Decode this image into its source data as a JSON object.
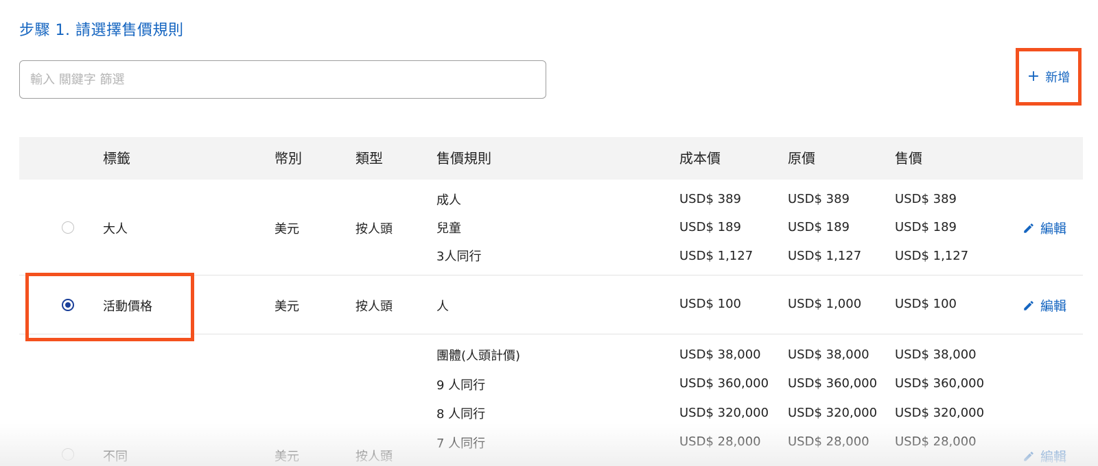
{
  "step_title": "步驟 1. 請選擇售價規則",
  "search": {
    "placeholder": "輸入 關鍵字 篩選",
    "value": ""
  },
  "add_button": {
    "icon": "plus-icon",
    "label": "新增"
  },
  "colors": {
    "accent": "#1565c0",
    "highlight": "#f4511e",
    "radio_checked": "#1a3f99",
    "header_bg": "#f3f3f3"
  },
  "table": {
    "headers": {
      "label": "標籤",
      "currency": "幣別",
      "type": "類型",
      "rule": "售價規則",
      "cost": "成本價",
      "original": "原價",
      "sale": "售價"
    },
    "rows": [
      {
        "selected": false,
        "label": "大人",
        "currency": "美元",
        "type": "按人頭",
        "rules": [
          {
            "name": "成人",
            "cost": "USD$ 389",
            "original": "USD$ 389",
            "sale": "USD$ 389"
          },
          {
            "name": "兒童",
            "cost": "USD$ 189",
            "original": "USD$ 189",
            "sale": "USD$ 189"
          },
          {
            "name": "3人同行",
            "cost": "USD$ 1,127",
            "original": "USD$ 1,127",
            "sale": "USD$ 1,127"
          }
        ],
        "edit_label": "編輯"
      },
      {
        "selected": true,
        "label": "活動價格",
        "currency": "美元",
        "type": "按人頭",
        "rules": [
          {
            "name": "人",
            "cost": "USD$ 100",
            "original": "USD$ 1,000",
            "sale": "USD$ 100"
          }
        ],
        "edit_label": "編輯"
      },
      {
        "selected": false,
        "label": "不同",
        "currency": "美元",
        "type": "按人頭",
        "rules": [
          {
            "name": "團體(人頭計價)",
            "cost": "USD$ 38,000",
            "original": "USD$ 38,000",
            "sale": "USD$ 38,000"
          },
          {
            "name": "9 人同行",
            "cost": "USD$ 360,000",
            "original": "USD$ 360,000",
            "sale": "USD$ 360,000"
          },
          {
            "name": "8 人同行",
            "cost": "USD$ 320,000",
            "original": "USD$ 320,000",
            "sale": "USD$ 320,000"
          },
          {
            "name": "7 人同行",
            "cost": "USD$ 28,000",
            "original": "USD$ 28,000",
            "sale": "USD$ 28,000"
          }
        ],
        "edit_label": "編輯"
      }
    ]
  }
}
